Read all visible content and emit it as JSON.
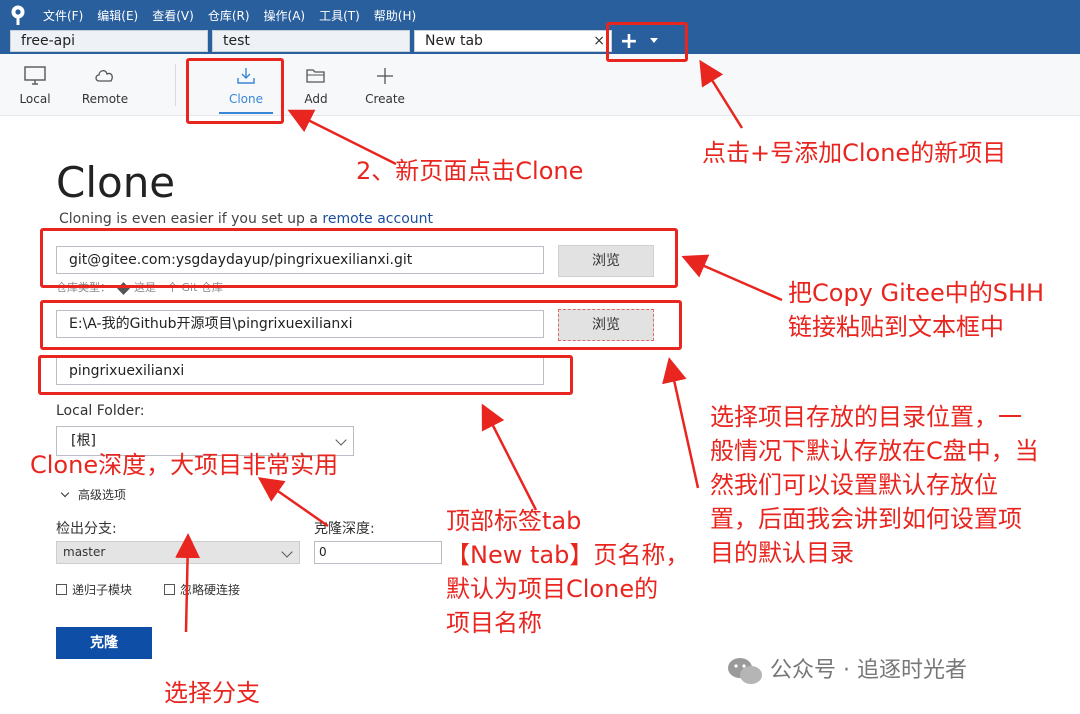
{
  "menu": [
    "文件(F)",
    "编辑(E)",
    "查看(V)",
    "仓库(R)",
    "操作(A)",
    "工具(T)",
    "帮助(H)"
  ],
  "tabs": [
    {
      "label": "free-api"
    },
    {
      "label": "test"
    },
    {
      "label": "New tab"
    }
  ],
  "tab_close": "×",
  "tab_add": "+",
  "toolbar": {
    "local": "Local",
    "remote": "Remote",
    "clone": "Clone",
    "add": "Add",
    "create": "Create"
  },
  "page": {
    "title": "Clone",
    "subtitle_prefix": "Cloning is even easier if you set up a ",
    "subtitle_link": "remote account"
  },
  "form": {
    "source_url": "git@gitee.com:ysgdaydayup/pingrixuexilianxi.git",
    "browse_label": "浏览",
    "repo_type_label": "仓库类型：",
    "repo_type_value": "这是一个 Git 仓库",
    "dest_path": "E:\\A-我的Github开源项目\\pingrixuexilianxi",
    "name": "pingrixuexilianxi",
    "local_folder_label": "Local Folder:",
    "local_folder_value": "[根]",
    "advanced_label": "高级选项",
    "branch_label": "检出分支:",
    "branch_value": "master",
    "depth_label": "克隆深度:",
    "depth_value": "0",
    "recurse_label": "递归子模块",
    "hardlink_label": "忽略硬连接",
    "clone_button": "克隆"
  },
  "annotations": {
    "plus_tip": "点击+号添加Clone的新项目",
    "step2": "2、新页面点击Clone",
    "ssh_tip_line1": "把Copy Gitee中的SHH",
    "ssh_tip_line2": "链接粘贴到文本框中",
    "dir_tip_line1": "选择项目存放的目录位置，一",
    "dir_tip_line2": "般情况下默认存放在C盘中，当",
    "dir_tip_line3": "然我们可以设置默认存放位",
    "dir_tip_line4": "置，后面我会讲到如何设置项",
    "dir_tip_line5": "目的默认目录",
    "depth_tip": "Clone深度，大项目非常实用",
    "name_tip_line1": "顶部标签tab",
    "name_tip_line2": "【New tab】页名称，",
    "name_tip_line3": "默认为项目Clone的",
    "name_tip_line4": "项目名称",
    "branch_tip": "选择分支",
    "color": "#e8251f"
  },
  "watermark": "公众号 · 追逐时光者"
}
